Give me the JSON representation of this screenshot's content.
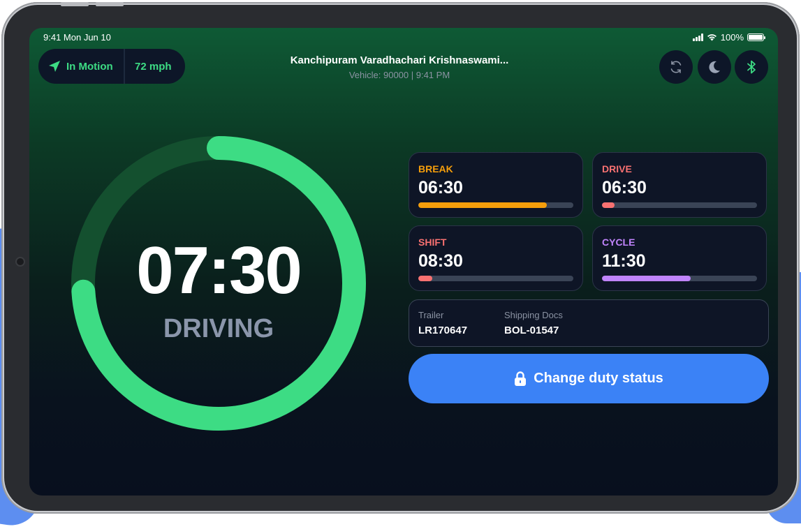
{
  "status_bar": {
    "time_date": "9:41 Mon Jun 10",
    "battery": "100%"
  },
  "header": {
    "motion_label": "In Motion",
    "speed": "72 mph",
    "driver_name": "Kanchipuram Varadhachari Krishnaswami...",
    "vehicle_info": "Vehicle: 90000 | 9:41 PM"
  },
  "icons": {
    "sync": "sync-icon",
    "theme": "moon-icon",
    "bluetooth": "bluetooth-icon",
    "navigation": "navigation-arrow-icon",
    "lock": "lock-icon"
  },
  "main_timer": {
    "time": "07:30",
    "status": "DRIVING",
    "progress": 0.74,
    "color": "#3ddc84"
  },
  "cards": [
    {
      "label": "BREAK",
      "value": "06:30",
      "color": "#f59e0b",
      "progress": 0.83
    },
    {
      "label": "DRIVE",
      "value": "06:30",
      "color": "#f87171",
      "progress": 0.08
    },
    {
      "label": "SHIFT",
      "value": "08:30",
      "color": "#f87171",
      "progress": 0.09
    },
    {
      "label": "CYCLE",
      "value": "11:30",
      "color": "#c084fc",
      "progress": 0.57
    }
  ],
  "info": {
    "trailer_label": "Trailer",
    "trailer_value": "LR170647",
    "docs_label": "Shipping Docs",
    "docs_value": "BOL-01547"
  },
  "duty_button": {
    "label": "Change duty status"
  }
}
